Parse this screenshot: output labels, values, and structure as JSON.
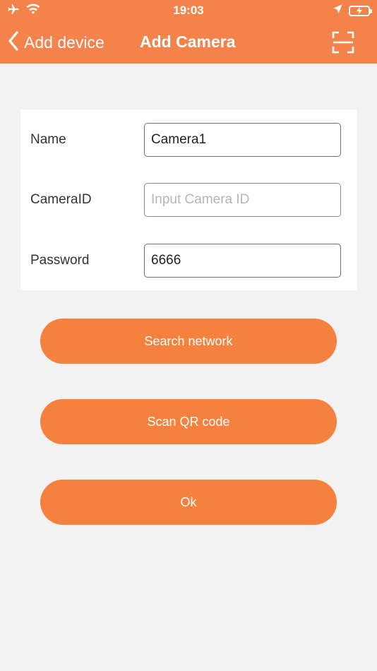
{
  "status_bar": {
    "time": "19:03",
    "icons": [
      "airplane-icon",
      "wifi-icon",
      "location-arrow-icon",
      "battery-charging-icon"
    ]
  },
  "nav": {
    "back_label": "Add device",
    "title": "Add Camera",
    "scan_icon": "scan-frame-icon"
  },
  "form": {
    "name": {
      "label": "Name",
      "value": "Camera1",
      "placeholder": ""
    },
    "camera_id": {
      "label": "CameraID",
      "value": "",
      "placeholder": "Input Camera ID"
    },
    "password": {
      "label": "Password",
      "value": "6666",
      "placeholder": ""
    }
  },
  "buttons": {
    "search_network": "Search network",
    "scan_qr": "Scan QR code",
    "ok": "Ok"
  },
  "colors": {
    "header": "#f4834b",
    "button": "#f4813d",
    "background": "#f2f2f2",
    "card": "#ffffff"
  }
}
